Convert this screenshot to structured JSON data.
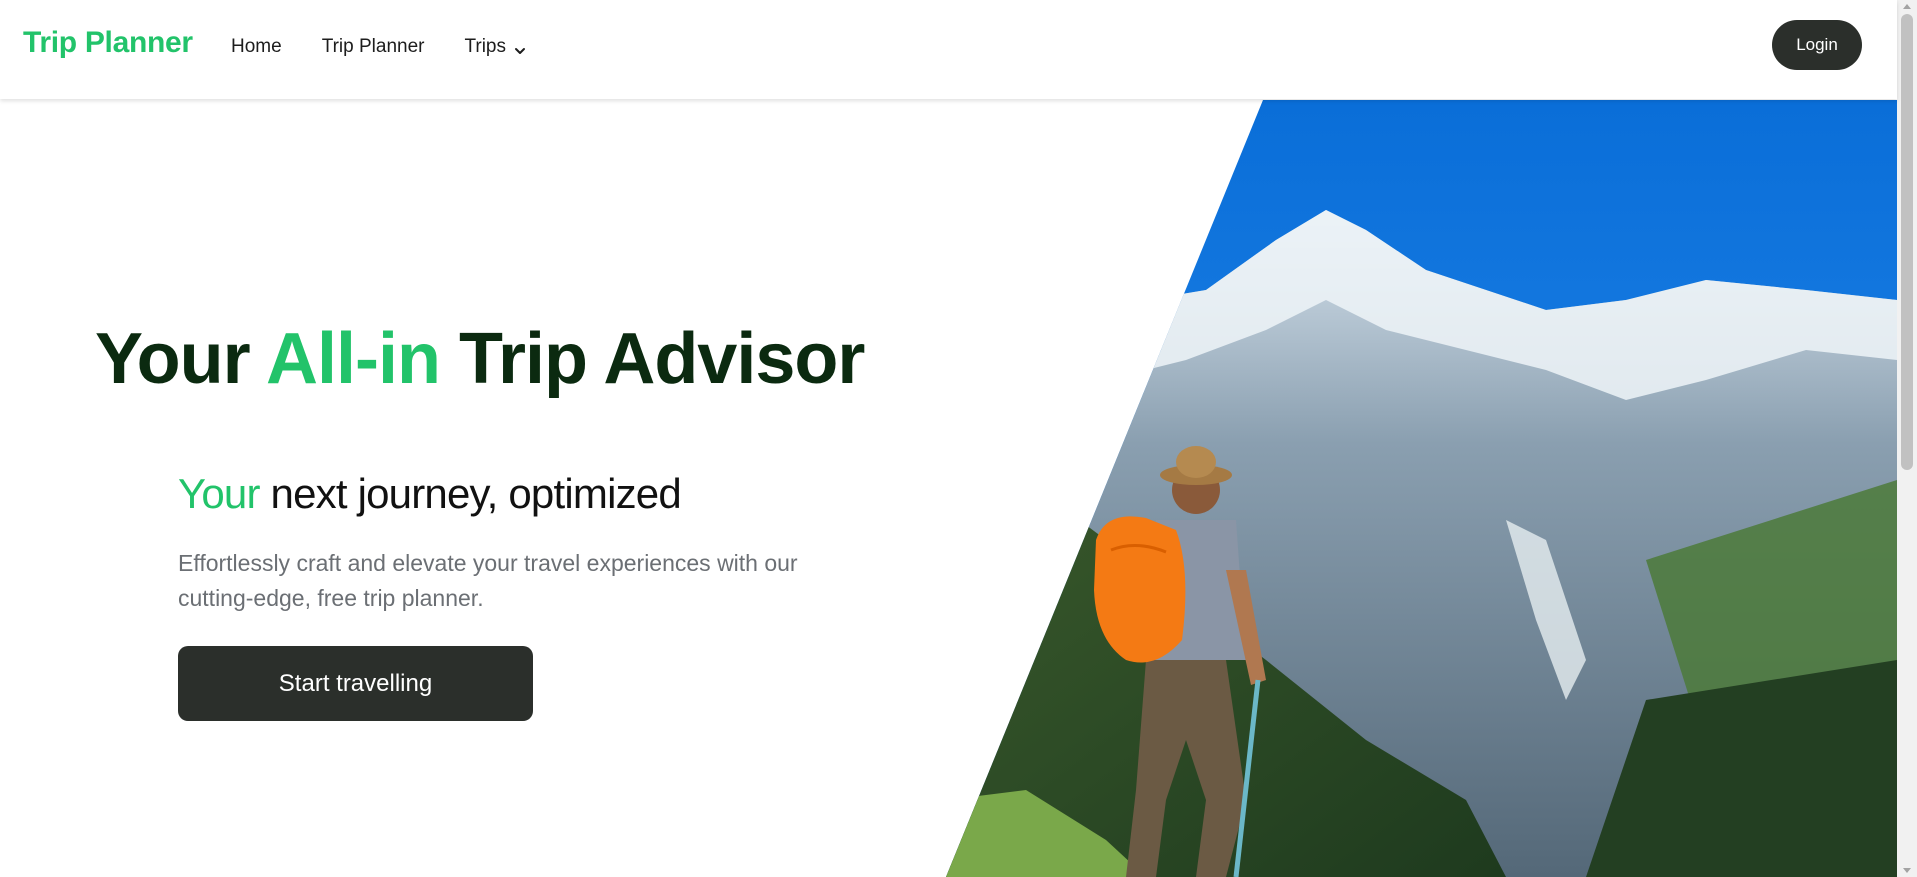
{
  "header": {
    "brand": "Trip Planner",
    "nav": [
      {
        "label": "Home"
      },
      {
        "label": "Trip Planner"
      },
      {
        "label": "Trips",
        "icon": "chevron-down-icon"
      }
    ],
    "login_label": "Login"
  },
  "hero": {
    "title_part1": "Your ",
    "title_accent": "All-in",
    "title_part2": " Trip Advisor",
    "subtitle_accent": "Your",
    "subtitle_rest": " next journey, optimized",
    "description": "Effortlessly craft and elevate your travel experiences with our cutting-edge, free trip planner.",
    "cta_label": "Start travelling"
  },
  "colors": {
    "accent": "#22c36a",
    "dark_button": "#2b2f2b",
    "title_dark": "#0b2a10",
    "description_gray": "#6b6f74"
  }
}
